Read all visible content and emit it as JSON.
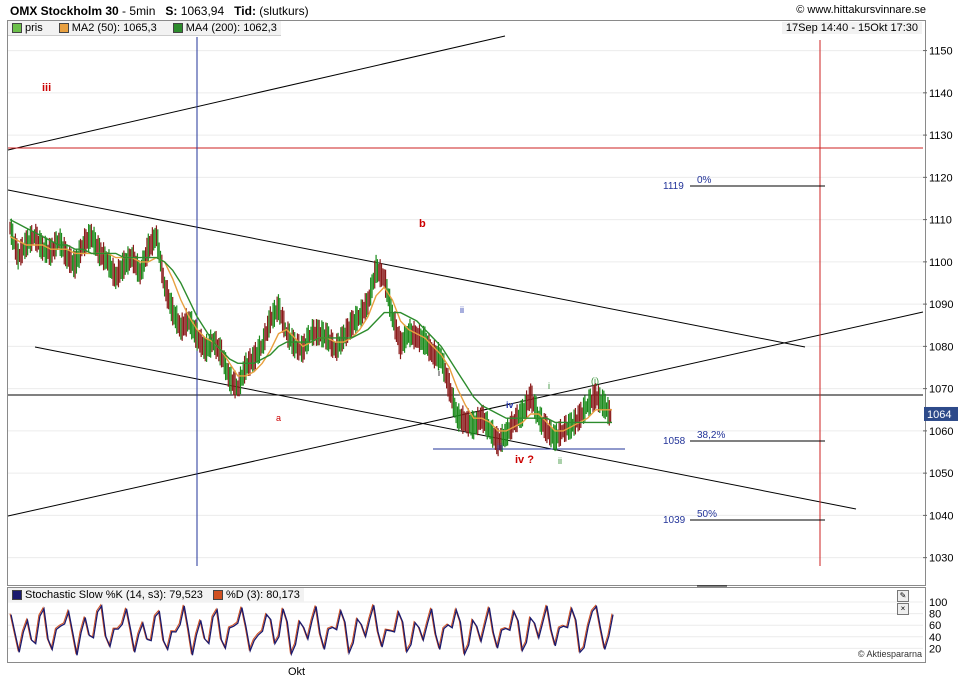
{
  "header": {
    "instrument": "OMX Stockholm 30",
    "interval": "5min",
    "last_label": "S:",
    "last_value": "1063,94",
    "time_label": "Tid:",
    "time_value": "(slutkurs)",
    "site": "© www.hittakursvinnare.se"
  },
  "legend": {
    "price": "pris",
    "ma_fast": "MA2 (50): 1065,3",
    "ma_slow": "MA4 (200): 1062,3",
    "period": "17Sep 14:40 - 15Okt 17:30"
  },
  "colors": {
    "price_up": "#1a8a1a",
    "price_down": "#8a1a1a",
    "ma_fast": "#e8a040",
    "ma_slow": "#2d8c2d",
    "trend": "#000000",
    "red_line": "#cc2222",
    "blue_line": "#223399",
    "stoch_k": "#1a1a6e",
    "stoch_d": "#d05020"
  },
  "stoch_legend": {
    "k": "Stochastic Slow %K (14, s3): 79,523",
    "d": "%D (3): 80,173"
  },
  "credit": "© Aktiespararna",
  "current_price_tag": "1064",
  "x_tick": "Okt",
  "fib_levels": [
    {
      "price": "1119",
      "label": "0%"
    },
    {
      "price": "1058",
      "label": "38,2%"
    },
    {
      "price": "1039",
      "label": "50%"
    }
  ],
  "wave_labels": [
    {
      "text": "iii",
      "color": "#cc0000"
    },
    {
      "text": "b",
      "color": "#cc0000"
    },
    {
      "text": "a",
      "color": "#cc0000"
    },
    {
      "text": "i",
      "color": "#000000"
    },
    {
      "text": "ii",
      "color": "#2233aa"
    },
    {
      "text": "iv",
      "color": "#2233aa"
    },
    {
      "text": "iii",
      "color": "#2233aa"
    },
    {
      "text": "iv ?",
      "color": "#cc0000"
    },
    {
      "text": "i",
      "color": "#2d8c2d"
    },
    {
      "text": "ii",
      "color": "#2d8c2d"
    },
    {
      "text": "(i)",
      "color": "#2d8c2d"
    }
  ],
  "chart_data": {
    "type": "line",
    "title": "OMX Stockholm 30 - 5min",
    "y_ticks": [
      1030,
      1040,
      1050,
      1060,
      1070,
      1080,
      1090,
      1100,
      1110,
      1120,
      1130,
      1140,
      1150
    ],
    "ylim": [
      1024,
      1157
    ],
    "x_range": [
      "17Sep 14:40",
      "15Okt 17:30"
    ],
    "series": [
      {
        "name": "pris",
        "values": [
          1108,
          1101,
          1104,
          1106,
          1103,
          1102,
          1105,
          1101,
          1099,
          1104,
          1106,
          1102,
          1100,
          1096,
          1099,
          1101,
          1097,
          1103,
          1106,
          1094,
          1088,
          1084,
          1086,
          1082,
          1079,
          1081,
          1078,
          1072,
          1070,
          1075,
          1077,
          1080,
          1086,
          1089,
          1083,
          1080,
          1079,
          1083,
          1083,
          1082,
          1079,
          1082,
          1085,
          1087,
          1090,
          1098,
          1096,
          1087,
          1080,
          1083,
          1082,
          1081,
          1078,
          1077,
          1070,
          1063,
          1062,
          1061,
          1063,
          1060,
          1057,
          1059,
          1062,
          1064,
          1068,
          1063,
          1060,
          1058,
          1060,
          1061,
          1063,
          1066,
          1068,
          1066,
          1063
        ]
      },
      {
        "name": "MA2 (50)",
        "values": [
          1106,
          1105,
          1104,
          1104,
          1104,
          1103,
          1103,
          1103,
          1102,
          1102,
          1102,
          1102,
          1102,
          1101,
          1101,
          1101,
          1100,
          1100,
          1101,
          1100,
          1096,
          1091,
          1087,
          1084,
          1082,
          1081,
          1079,
          1076,
          1073,
          1073,
          1074,
          1076,
          1079,
          1083,
          1084,
          1082,
          1080,
          1081,
          1082,
          1082,
          1081,
          1081,
          1082,
          1084,
          1087,
          1092,
          1094,
          1091,
          1086,
          1084,
          1083,
          1082,
          1080,
          1078,
          1075,
          1070,
          1066,
          1063,
          1063,
          1062,
          1060,
          1060,
          1061,
          1062,
          1064,
          1064,
          1062,
          1060,
          1060,
          1061,
          1062,
          1063,
          1065,
          1065,
          1065
        ]
      },
      {
        "name": "MA4 (200)",
        "values": [
          1110,
          1109,
          1108,
          1107,
          1106,
          1105,
          1104,
          1104,
          1103,
          1103,
          1102,
          1102,
          1102,
          1102,
          1101,
          1101,
          1101,
          1101,
          1101,
          1100,
          1098,
          1095,
          1091,
          1087,
          1084,
          1081,
          1079,
          1077,
          1076,
          1076,
          1076,
          1077,
          1078,
          1080,
          1081,
          1081,
          1081,
          1081,
          1082,
          1082,
          1082,
          1082,
          1082,
          1083,
          1084,
          1086,
          1088,
          1088,
          1088,
          1087,
          1086,
          1084,
          1082,
          1080,
          1077,
          1074,
          1071,
          1068,
          1066,
          1065,
          1064,
          1063,
          1063,
          1063,
          1063,
          1063,
          1063,
          1062,
          1062,
          1062,
          1062,
          1062,
          1062,
          1062,
          1062
        ]
      }
    ],
    "stochastic": {
      "y_ticks": [
        20,
        40,
        60,
        80,
        100
      ],
      "ylim": [
        0,
        100
      ],
      "k_values": [
        80,
        15,
        70,
        30,
        90,
        20,
        60,
        85,
        10,
        75,
        40,
        95,
        25,
        55,
        90,
        15,
        65,
        35,
        85,
        20,
        50,
        95,
        10,
        70,
        30,
        88,
        22,
        60,
        92,
        18,
        45,
        80,
        30,
        90,
        12,
        68,
        38,
        94,
        20,
        58,
        86,
        14,
        72,
        42,
        96,
        24,
        52,
        84,
        16,
        66,
        36,
        90,
        20,
        62,
        88,
        12,
        70,
        34,
        92,
        22,
        56,
        85,
        18,
        74,
        40,
        95,
        26,
        60,
        90,
        15,
        60,
        94,
        20,
        80
      ]
    }
  }
}
